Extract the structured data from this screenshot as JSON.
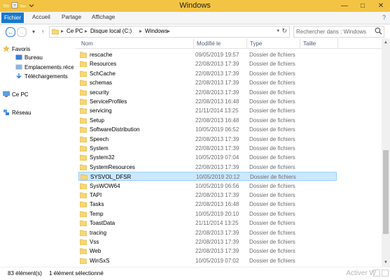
{
  "window": {
    "title": "Windows"
  },
  "ribbon": {
    "tabs": [
      "Fichier",
      "Accueil",
      "Partage",
      "Affichage"
    ],
    "help": "?"
  },
  "address": {
    "crumbs": [
      "Ce PC",
      "Disque local (C:)",
      "Windows"
    ],
    "sep": "▸"
  },
  "search": {
    "placeholder": "Rechercher dans : Windows"
  },
  "nav": {
    "favorites": "Favoris",
    "bureau": "Bureau",
    "emplacements": "Emplacements récents",
    "telechargements": "Téléchargements",
    "ce_pc": "Ce PC",
    "reseau": "Réseau"
  },
  "columns": {
    "name": "Nom",
    "modified": "Modifié le",
    "type": "Type",
    "size": "Taille"
  },
  "files": [
    {
      "name": "rescache",
      "date": "09/05/2019 19:57",
      "type": "Dossier de fichiers"
    },
    {
      "name": "Resources",
      "date": "22/08/2013 17:39",
      "type": "Dossier de fichiers"
    },
    {
      "name": "SchCache",
      "date": "22/08/2013 17:39",
      "type": "Dossier de fichiers"
    },
    {
      "name": "schemas",
      "date": "22/08/2013 17:39",
      "type": "Dossier de fichiers"
    },
    {
      "name": "security",
      "date": "22/08/2013 17:39",
      "type": "Dossier de fichiers"
    },
    {
      "name": "ServiceProfiles",
      "date": "22/08/2013 16:48",
      "type": "Dossier de fichiers"
    },
    {
      "name": "servicing",
      "date": "21/11/2014 13:25",
      "type": "Dossier de fichiers"
    },
    {
      "name": "Setup",
      "date": "22/08/2013 16:48",
      "type": "Dossier de fichiers"
    },
    {
      "name": "SoftwareDistribution",
      "date": "10/05/2019 06:52",
      "type": "Dossier de fichiers"
    },
    {
      "name": "Speech",
      "date": "22/08/2013 17:39",
      "type": "Dossier de fichiers"
    },
    {
      "name": "System",
      "date": "22/08/2013 17:39",
      "type": "Dossier de fichiers"
    },
    {
      "name": "System32",
      "date": "10/05/2019 07:04",
      "type": "Dossier de fichiers"
    },
    {
      "name": "SystemResources",
      "date": "22/08/2013 17:39",
      "type": "Dossier de fichiers"
    },
    {
      "name": "SYSVOL_DFSR",
      "date": "10/05/2019 20:12",
      "type": "Dossier de fichiers",
      "selected": true
    },
    {
      "name": "SysWOW64",
      "date": "10/05/2019 06:56",
      "type": "Dossier de fichiers"
    },
    {
      "name": "TAPI",
      "date": "22/08/2013 17:39",
      "type": "Dossier de fichiers"
    },
    {
      "name": "Tasks",
      "date": "22/08/2013 16:48",
      "type": "Dossier de fichiers"
    },
    {
      "name": "Temp",
      "date": "10/05/2019 20:10",
      "type": "Dossier de fichiers"
    },
    {
      "name": "ToastData",
      "date": "21/11/2014 13:25",
      "type": "Dossier de fichiers"
    },
    {
      "name": "tracing",
      "date": "22/08/2013 17:39",
      "type": "Dossier de fichiers"
    },
    {
      "name": "Vss",
      "date": "22/08/2013 17:39",
      "type": "Dossier de fichiers"
    },
    {
      "name": "Web",
      "date": "22/08/2013 17:39",
      "type": "Dossier de fichiers"
    },
    {
      "name": "WinSxS",
      "date": "10/05/2019 07:02",
      "type": "Dossier de fichiers"
    }
  ],
  "status": {
    "count": "83 élément(s)",
    "selected": "1 élément sélectionné"
  },
  "watermark": "Activer W",
  "colors": {
    "titlebar": "#f3c443",
    "accent": "#1979ca",
    "selection": "#cce8ff",
    "folder": "#f8d775"
  }
}
